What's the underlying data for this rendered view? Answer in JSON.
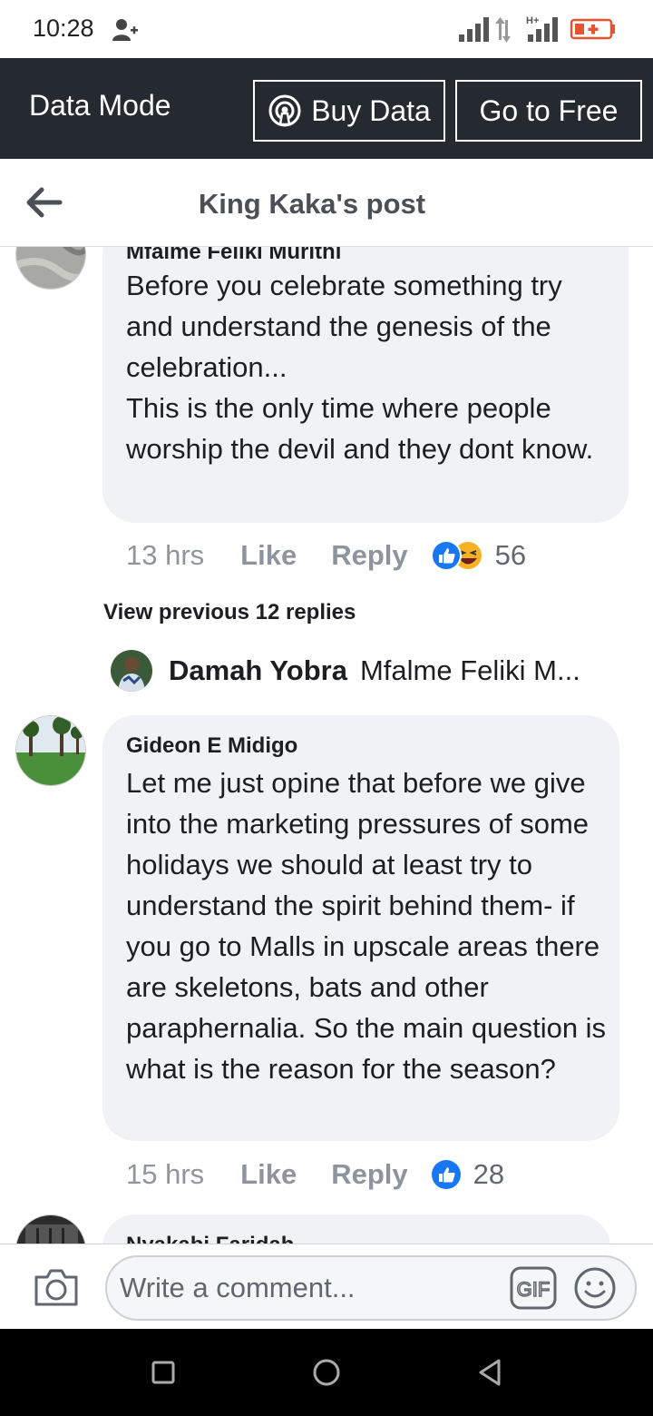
{
  "status_bar": {
    "time": "10:28",
    "network_label": "H+"
  },
  "data_bar": {
    "label": "Data Mode",
    "buy_data": "Buy Data",
    "go_to_free": "Go to Free"
  },
  "header": {
    "title": "King Kaka's post"
  },
  "comments": [
    {
      "author": "Mfalme Feliki Murithi",
      "text": "Before you celebrate something try and understand the genesis of the celebration...\nThis is the only time where people worship the devil and they dont know.",
      "time": "13 hrs",
      "like": "Like",
      "reply": "Reply",
      "reactions": [
        "like-icon",
        "haha-icon"
      ],
      "reaction_count": "56"
    },
    {
      "author": "Gideon E Midigo",
      "text": "Let me just opine that before we give into the marketing pressures of some holidays we should at least try to understand the spirit behind them- if you go to Malls in upscale areas there are skeletons, bats and other paraphernalia. So the main question is what is the reason for the season?",
      "time": "15 hrs",
      "like": "Like",
      "reply": "Reply",
      "reactions": [
        "like-icon"
      ],
      "reaction_count": "28"
    },
    {
      "author": "Nyakabi Faridah"
    }
  ],
  "view_previous": "View previous 12 replies",
  "reply_preview": {
    "name": "Damah Yobra",
    "snippet": "Mfalme Feliki M..."
  },
  "composer": {
    "placeholder": "Write a comment...",
    "gif_label": "GIF"
  },
  "colors": {
    "data_bar_bg": "#252a31",
    "bubble_bg": "#f0f2f5",
    "like_blue": "#1877f2",
    "haha_yellow": "#f7b125"
  }
}
